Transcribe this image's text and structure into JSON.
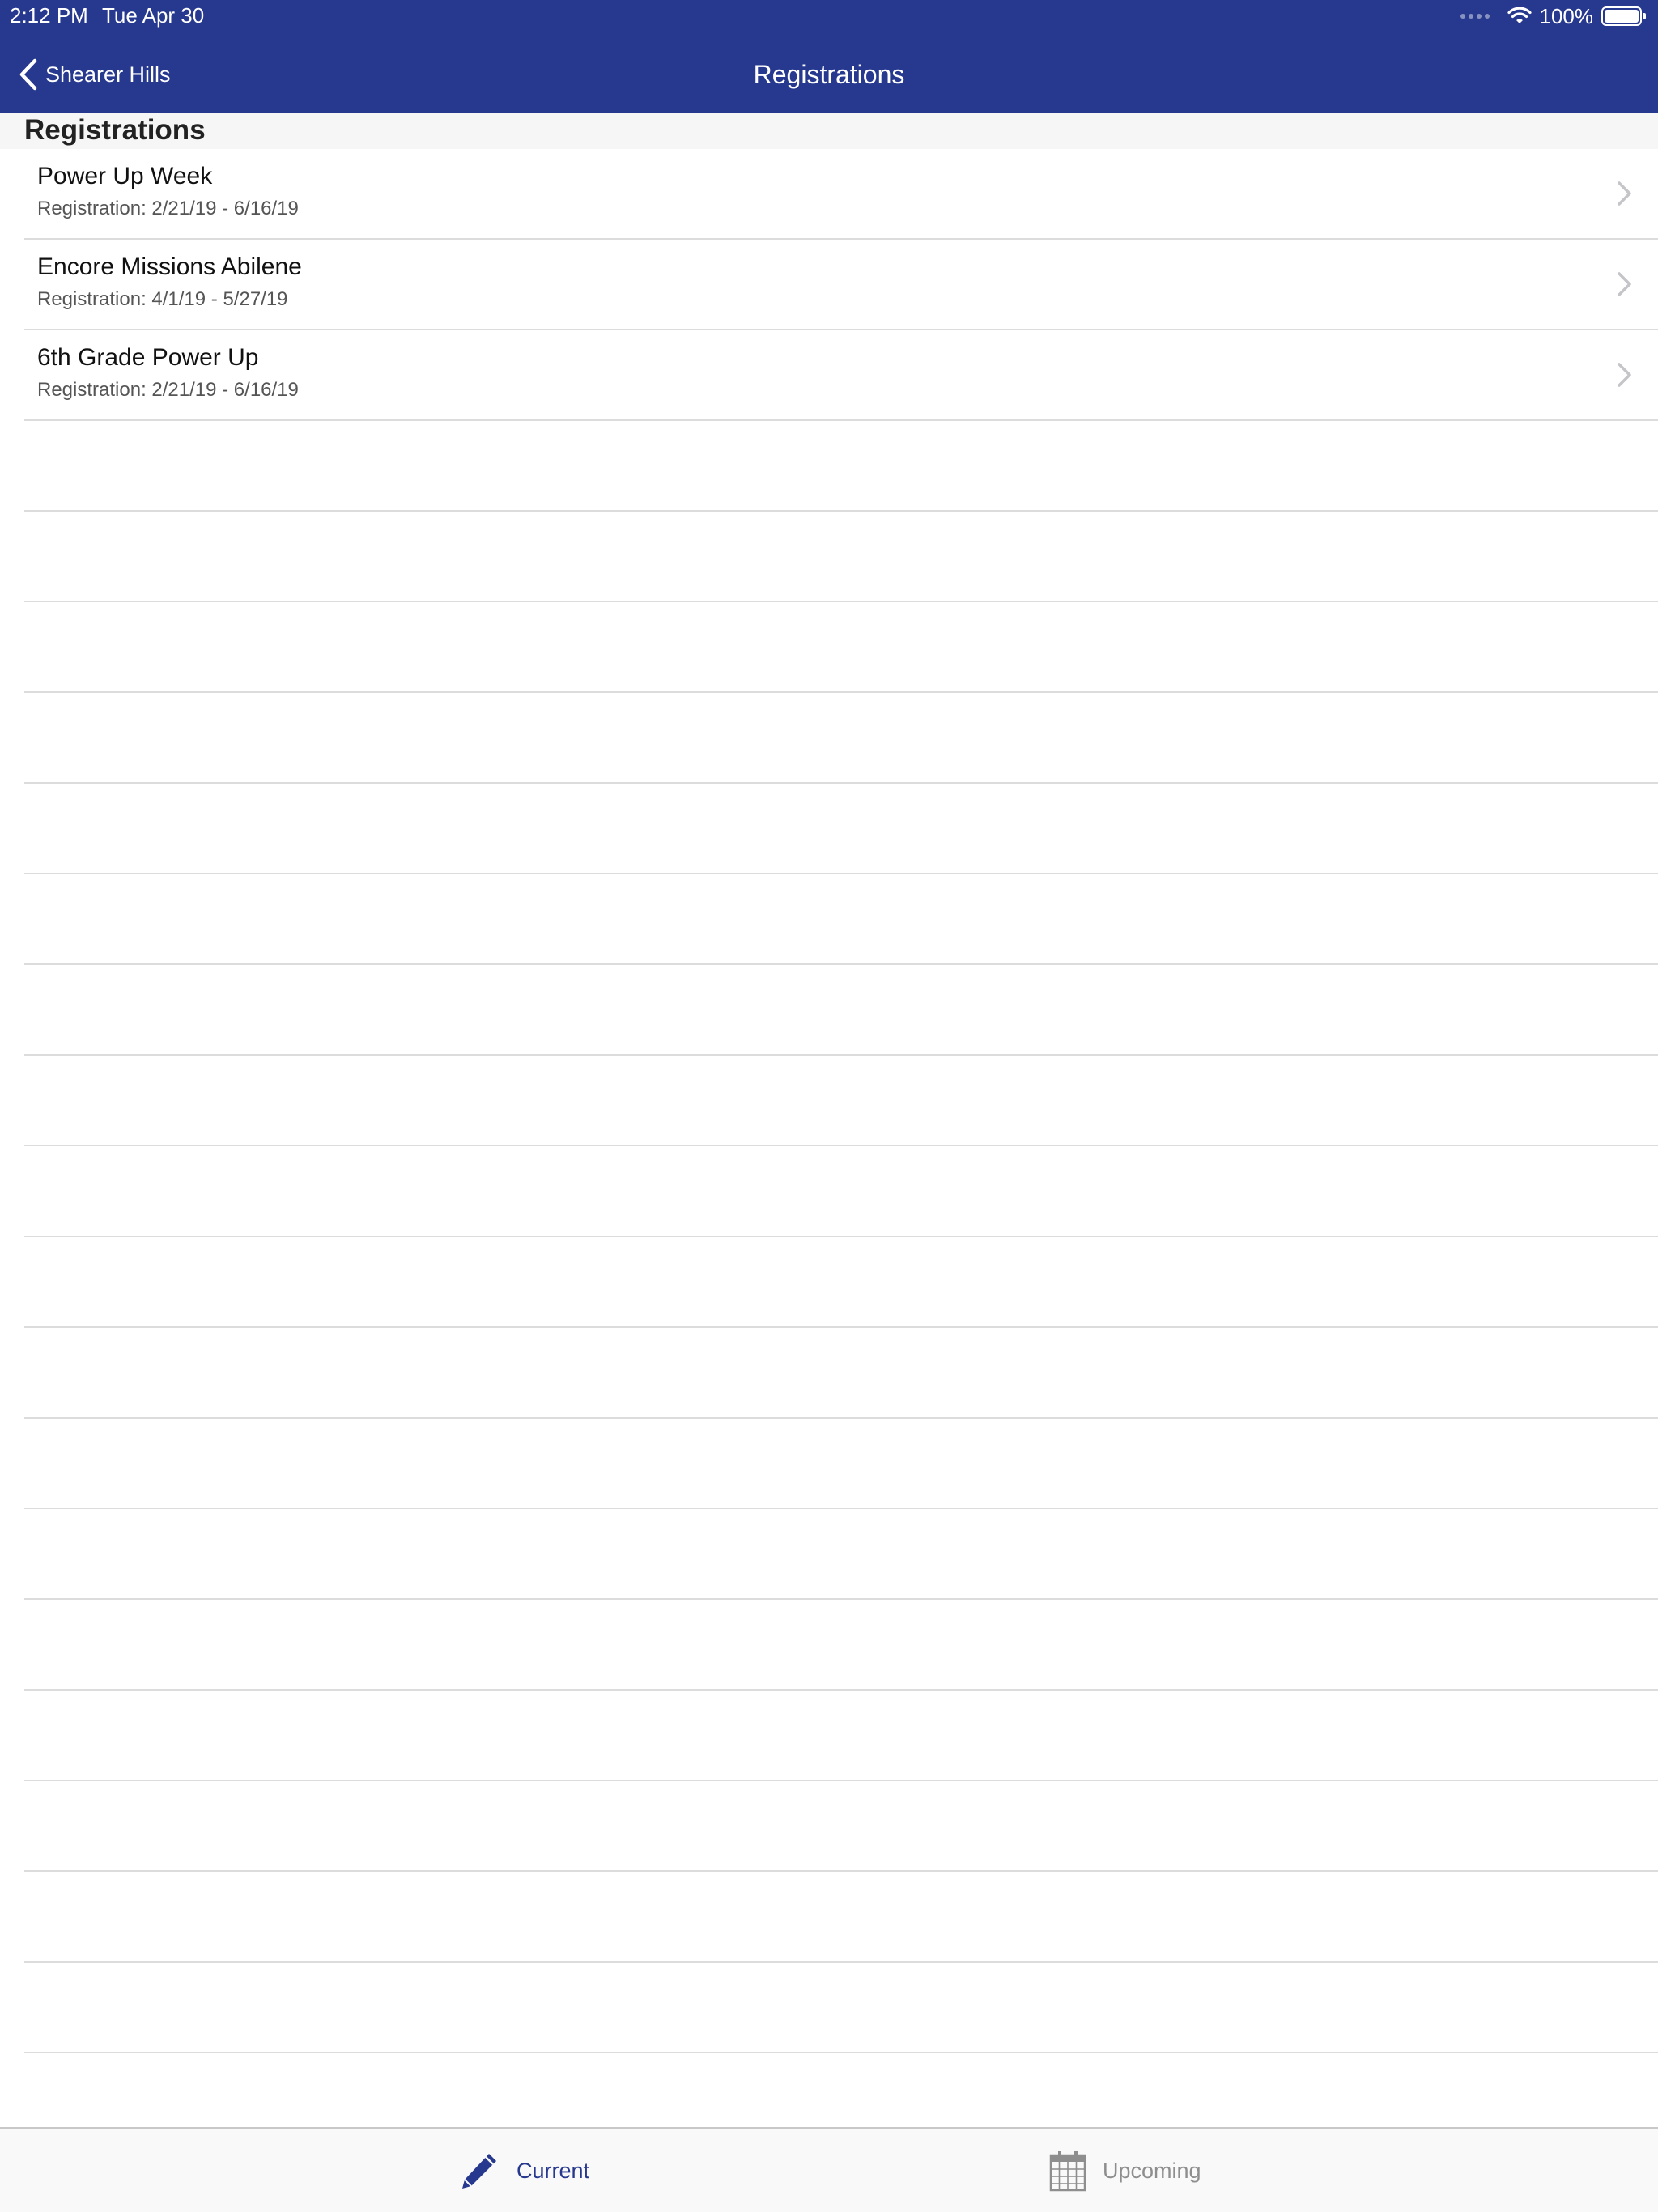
{
  "status_bar": {
    "time": "2:12 PM",
    "date": "Tue Apr 30",
    "battery": "100%"
  },
  "nav": {
    "back_label": "Shearer Hills",
    "title": "Registrations"
  },
  "section": {
    "header": "Registrations"
  },
  "registrations": [
    {
      "title": "Power Up Week",
      "subtitle": "Registration: 2/21/19 - 6/16/19"
    },
    {
      "title": "Encore Missions Abilene",
      "subtitle": "Registration: 4/1/19 - 5/27/19"
    },
    {
      "title": "6th Grade Power Up",
      "subtitle": "Registration: 2/21/19 - 6/16/19"
    }
  ],
  "tabs": {
    "current": "Current",
    "upcoming": "Upcoming"
  },
  "colors": {
    "brand": "#27398f",
    "inactive": "#8e8e8e"
  }
}
